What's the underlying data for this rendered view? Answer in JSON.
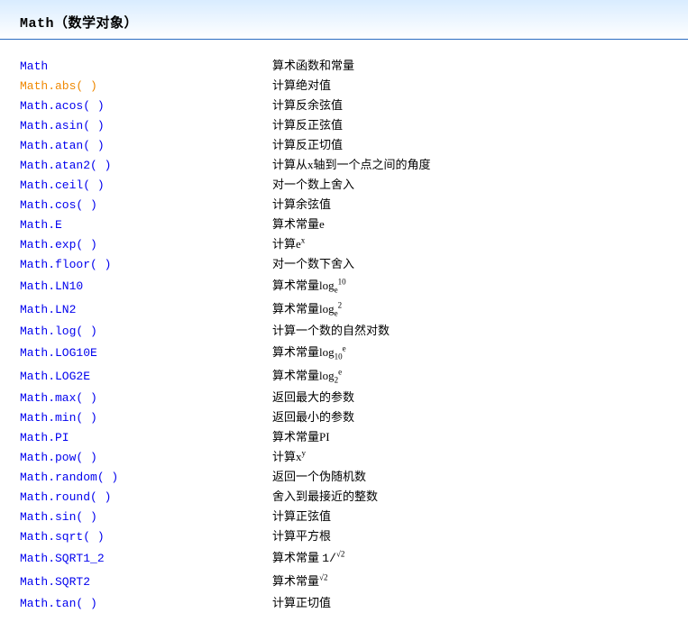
{
  "header": {
    "title": "Math（数学对象）"
  },
  "rows": [
    {
      "name": "Math",
      "desc": "算术函数和常量",
      "active": false
    },
    {
      "name": "Math.abs( )",
      "desc": "计算绝对值",
      "active": true
    },
    {
      "name": "Math.acos( )",
      "desc": "计算反余弦值",
      "active": false
    },
    {
      "name": "Math.asin( )",
      "desc": "计算反正弦值",
      "active": false
    },
    {
      "name": "Math.atan( )",
      "desc": "计算反正切值",
      "active": false
    },
    {
      "name": "Math.atan2( )",
      "desc": "计算从x轴到一个点之间的角度",
      "active": false
    },
    {
      "name": "Math.ceil( )",
      "desc": "对一个数上舍入",
      "active": false
    },
    {
      "name": "Math.cos( )",
      "desc": "计算余弦值",
      "active": false
    },
    {
      "name": "Math.E",
      "desc": "算术常量e",
      "active": false
    },
    {
      "name": "Math.exp( )",
      "desc_html": "计算e<sup>x</sup>",
      "active": false
    },
    {
      "name": "Math.floor( )",
      "desc": "对一个数下舍入",
      "active": false
    },
    {
      "name": "Math.LN10",
      "desc_html": "算术常量log<sub>e</sub><sup>10</sup>",
      "active": false,
      "tall": true
    },
    {
      "name": "Math.LN2",
      "desc_html": "算术常量log<sub>e</sub><sup>2</sup>",
      "active": false,
      "tall": true
    },
    {
      "name": "Math.log( )",
      "desc": "计算一个数的自然对数",
      "active": false
    },
    {
      "name": "Math.LOG10E",
      "desc_html": "算术常量log<sub>10</sub><sup>e</sup>",
      "active": false,
      "tall": true
    },
    {
      "name": "Math.LOG2E",
      "desc_html": "算术常量log<sub>2</sub><sup>e</sup>",
      "active": false,
      "tall": true
    },
    {
      "name": "Math.max( )",
      "desc": "返回最大的参数",
      "active": false
    },
    {
      "name": "Math.min( )",
      "desc": "返回最小的参数",
      "active": false
    },
    {
      "name": "Math.PI",
      "desc": "算术常量PI",
      "active": false
    },
    {
      "name": "Math.pow( )",
      "desc_html": "计算x<sup>y</sup>",
      "active": false
    },
    {
      "name": "Math.random( )",
      "desc": "返回一个伪随机数",
      "active": false
    },
    {
      "name": "Math.round( )",
      "desc": "舍入到最接近的整数",
      "active": false
    },
    {
      "name": "Math.sin( )",
      "desc": "计算正弦值",
      "active": false
    },
    {
      "name": "Math.sqrt( )",
      "desc": "计算平方根",
      "active": false
    },
    {
      "name": "Math.SQRT1_2",
      "desc_html": "算术常量 <span class='mono'>1/</span><sup>√2</sup>",
      "active": false,
      "tall": true
    },
    {
      "name": "Math.SQRT2",
      "desc_html": "算术常量<sup>√2</sup>",
      "active": false,
      "tall": true
    },
    {
      "name": "Math.tan( )",
      "desc": "计算正切值",
      "active": false
    }
  ]
}
